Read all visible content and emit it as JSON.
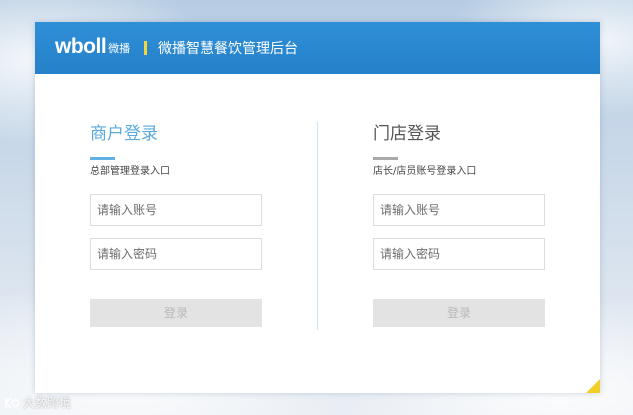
{
  "header": {
    "logo_word": "wboll",
    "logo_sub": "微播",
    "system_title": "微播智慧餐饮管理后台"
  },
  "merchant_login": {
    "title": "商户登录",
    "subtitle": "总部管理登录入口",
    "account_placeholder": "请输入账号",
    "password_placeholder": "请输入密码",
    "submit_label": "登录"
  },
  "store_login": {
    "title": "门店登录",
    "subtitle": "店长/店员账号登录入口",
    "account_placeholder": "请输入账号",
    "password_placeholder": "请输入密码",
    "submit_label": "登录"
  },
  "watermark": {
    "text": "大数跨境"
  },
  "colors": {
    "header_blue": "#2a88d0",
    "accent_yellow": "#f2d53c",
    "merchant_title": "#5aa9dc",
    "store_title": "#555555",
    "button_bg": "#e3e3e3"
  }
}
